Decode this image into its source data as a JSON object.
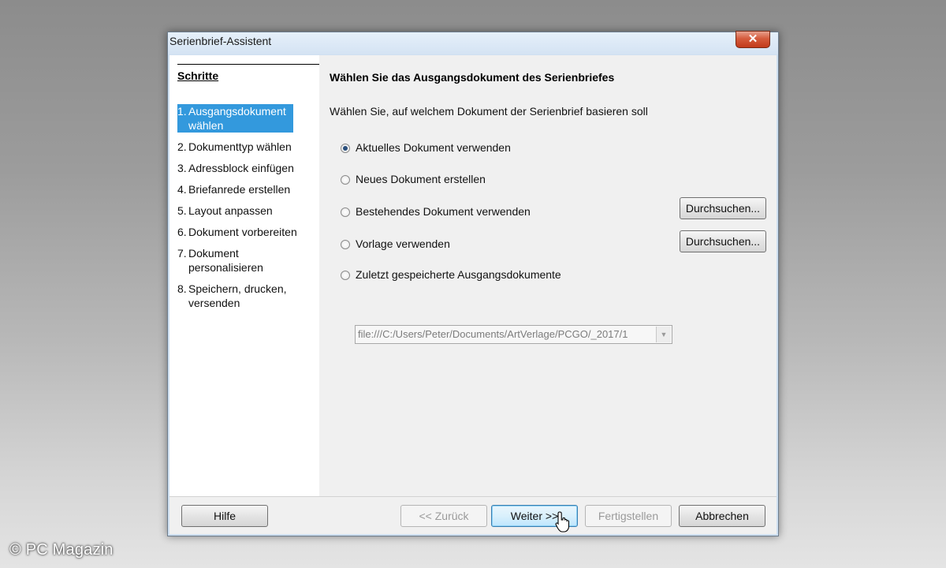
{
  "window": {
    "title": "Serienbrief-Assistent",
    "close_glyph": "✕"
  },
  "sidebar": {
    "heading": "Schritte",
    "steps": [
      {
        "num": "1.",
        "label": "Ausgangsdokument wählen",
        "active": true
      },
      {
        "num": "2.",
        "label": "Dokumenttyp wählen"
      },
      {
        "num": "3.",
        "label": "Adressblock einfügen"
      },
      {
        "num": "4.",
        "label": "Briefanrede erstellen"
      },
      {
        "num": "5.",
        "label": "Layout anpassen"
      },
      {
        "num": "6.",
        "label": "Dokument vorbereiten"
      },
      {
        "num": "7.",
        "label": "Dokument personalisieren"
      },
      {
        "num": "8.",
        "label": "Speichern, drucken, versenden"
      }
    ]
  },
  "main": {
    "title": "Wählen Sie das Ausgangsdokument des Serienbriefes",
    "subtitle": "Wählen Sie, auf welchem Dokument der Serienbrief basieren soll",
    "options": [
      {
        "label": "Aktuelles Dokument verwenden",
        "checked": true
      },
      {
        "label": "Neues Dokument erstellen",
        "checked": false
      },
      {
        "label": "Bestehendes Dokument verwenden",
        "checked": false
      },
      {
        "label": "Vorlage verwenden",
        "checked": false
      },
      {
        "label": "Zuletzt gespeicherte Ausgangsdokumente",
        "checked": false
      }
    ],
    "browse_label": "Durchsuchen...",
    "recent_path": "file:///C:/Users/Peter/Documents/ArtVerlage/PCGO/_2017/1"
  },
  "footer": {
    "help": "Hilfe",
    "back": "<< Zurück",
    "next": "Weiter >>",
    "finish": "Fertigstellen",
    "cancel": "Abbrechen"
  },
  "watermark": "© PC Magazin"
}
